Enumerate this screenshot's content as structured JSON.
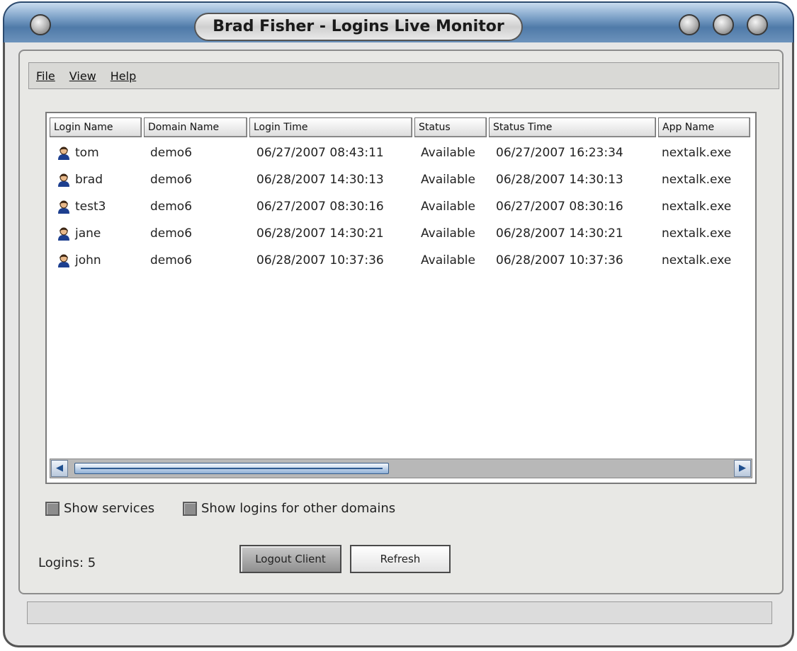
{
  "window": {
    "title": "Brad Fisher - Logins Live Monitor"
  },
  "menu": {
    "items": [
      "File",
      "View",
      "Help"
    ]
  },
  "table": {
    "columns": [
      "Login Name",
      "Domain Name",
      "Login Time",
      "Status",
      "Status Time",
      "App Name"
    ],
    "rows": [
      [
        "tom",
        "demo6",
        "06/27/2007 08:43:11",
        "Available",
        "06/27/2007 16:23:34",
        "nextalk.exe"
      ],
      [
        "brad",
        "demo6",
        "06/28/2007 14:30:13",
        "Available",
        "06/28/2007 14:30:13",
        "nextalk.exe"
      ],
      [
        "test3",
        "demo6",
        "06/27/2007 08:30:16",
        "Available",
        "06/27/2007 08:30:16",
        "nextalk.exe"
      ],
      [
        "jane",
        "demo6",
        "06/28/2007 14:30:21",
        "Available",
        "06/28/2007 14:30:21",
        "nextalk.exe"
      ],
      [
        "john",
        "demo6",
        "06/28/2007 10:37:36",
        "Available",
        "06/28/2007 10:37:36",
        "nextalk.exe"
      ]
    ],
    "row_icon": "user-icon"
  },
  "options": {
    "show_services": {
      "label": "Show services",
      "checked": false
    },
    "show_other_domains": {
      "label": "Show logins for other domains",
      "checked": false
    }
  },
  "footer": {
    "logins_count": "Logins: 5",
    "logout_label": "Logout Client",
    "refresh_label": "Refresh"
  },
  "colors": {
    "titlebar": "#4f7aa8",
    "accent": "#1f4f8f",
    "window_bg": "#e6e6e6"
  }
}
